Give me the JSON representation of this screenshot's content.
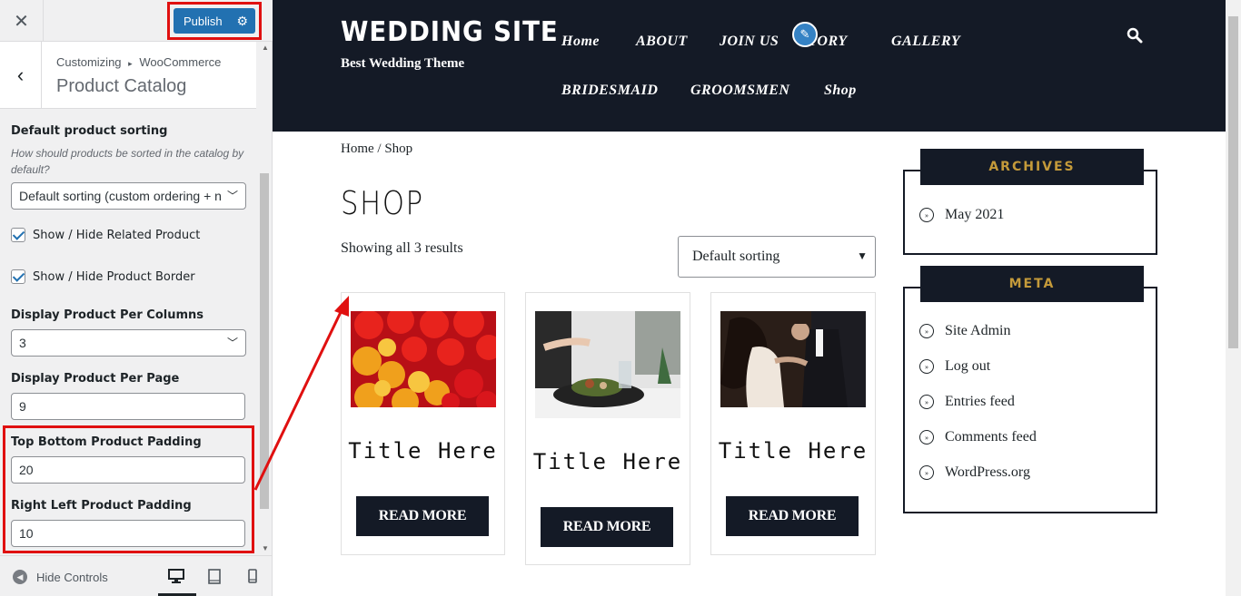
{
  "customizer": {
    "publish_label": "Publish",
    "breadcrumb_root": "Customizing",
    "breadcrumb_sep": "▸",
    "breadcrumb_parent": "WooCommerce",
    "section_title": "Product Catalog",
    "controls": {
      "sorting_label": "Default product sorting",
      "sorting_desc": "How should products be sorted in the catalog by default?",
      "sorting_value": "Default sorting (custom ordering + n",
      "related_label": "Show / Hide Related Product",
      "border_label": "Show / Hide Product Border",
      "columns_label": "Display Product Per Columns",
      "columns_value": "3",
      "per_page_label": "Display Product Per Page",
      "per_page_value": "9",
      "tb_padding_label": "Top Bottom Product Padding",
      "tb_padding_value": "20",
      "rl_padding_label": "Right Left Product Padding",
      "rl_padding_value": "10"
    },
    "hide_controls_label": "Hide Controls"
  },
  "site": {
    "title": "WEDDING SITE",
    "tagline": "Best Wedding Theme",
    "nav": [
      "Home",
      "ABOUT",
      "JOIN US",
      "STORY",
      "GALLERY",
      "BRIDESMAID",
      "GROOMSMEN",
      "Shop"
    ],
    "breadcrumb": "Home / Shop",
    "shop_title": "SHOP",
    "result_count": "Showing all 3 results",
    "orderby_value": "Default sorting",
    "products": [
      {
        "title": "Title Here",
        "button": "READ MORE"
      },
      {
        "title": "Title Here",
        "button": "READ MORE"
      },
      {
        "title": "Title Here",
        "button": "READ MORE"
      }
    ],
    "widgets": {
      "archives_title": "ARCHIVES",
      "archives_items": [
        "May 2021"
      ],
      "meta_title": "META",
      "meta_items": [
        "Site Admin",
        "Log out",
        "Entries feed",
        "Comments feed",
        "WordPress.org"
      ]
    }
  },
  "colors": {
    "header_bg": "#141a26",
    "accent_gold": "#c49a3a",
    "wp_blue": "#2271b1",
    "highlight_red": "#e01010"
  }
}
